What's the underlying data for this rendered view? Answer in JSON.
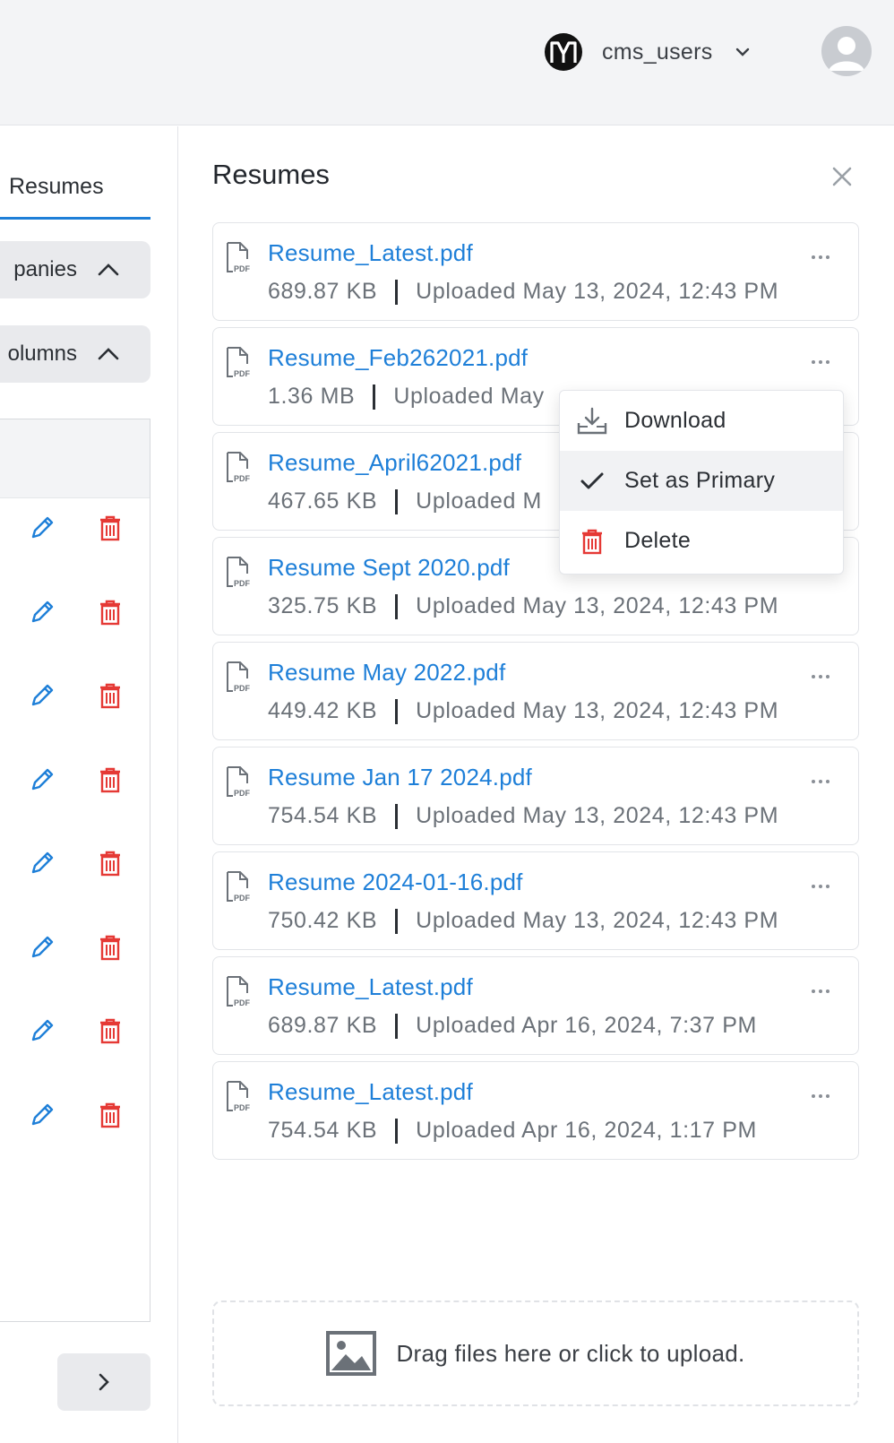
{
  "header": {
    "org_name": "cms_users",
    "logo_icon": "brand-logo-icon",
    "avatar_icon": "user-avatar-icon"
  },
  "left_panel": {
    "tab_label": "Resumes",
    "filter_companies": "panies",
    "filter_columns": "olumns",
    "row_count": 8
  },
  "drawer": {
    "title": "Resumes",
    "close_icon": "close-icon",
    "files": [
      {
        "name": "Resume_Latest.pdf",
        "size": "689.87 KB",
        "uploaded": "Uploaded May 13, 2024, 12:43 PM"
      },
      {
        "name": "Resume_Feb262021.pdf",
        "size": "1.36 MB",
        "uploaded": "Uploaded May"
      },
      {
        "name": "Resume_April62021.pdf",
        "size": "467.65 KB",
        "uploaded": "Uploaded M"
      },
      {
        "name": "Resume Sept 2020.pdf",
        "size": "325.75 KB",
        "uploaded": "Uploaded May 13, 2024, 12:43 PM"
      },
      {
        "name": "Resume May 2022.pdf",
        "size": "449.42 KB",
        "uploaded": "Uploaded May 13, 2024, 12:43 PM"
      },
      {
        "name": "Resume Jan 17 2024.pdf",
        "size": "754.54 KB",
        "uploaded": "Uploaded May 13, 2024, 12:43 PM"
      },
      {
        "name": "Resume 2024-01-16.pdf",
        "size": "750.42 KB",
        "uploaded": "Uploaded May 13, 2024, 12:43 PM"
      },
      {
        "name": "Resume_Latest.pdf",
        "size": "689.87 KB",
        "uploaded": "Uploaded Apr 16, 2024, 7:37 PM"
      },
      {
        "name": "Resume_Latest.pdf",
        "size": "754.54 KB",
        "uploaded": "Uploaded Apr 16, 2024, 1:17 PM"
      }
    ],
    "menu": {
      "download": "Download",
      "set_primary": "Set as Primary",
      "delete": "Delete"
    },
    "upload_text": "Drag files here or click to upload."
  },
  "colors": {
    "accent": "#1e7fd8",
    "danger": "#e53935",
    "muted_text": "#6b7178"
  }
}
